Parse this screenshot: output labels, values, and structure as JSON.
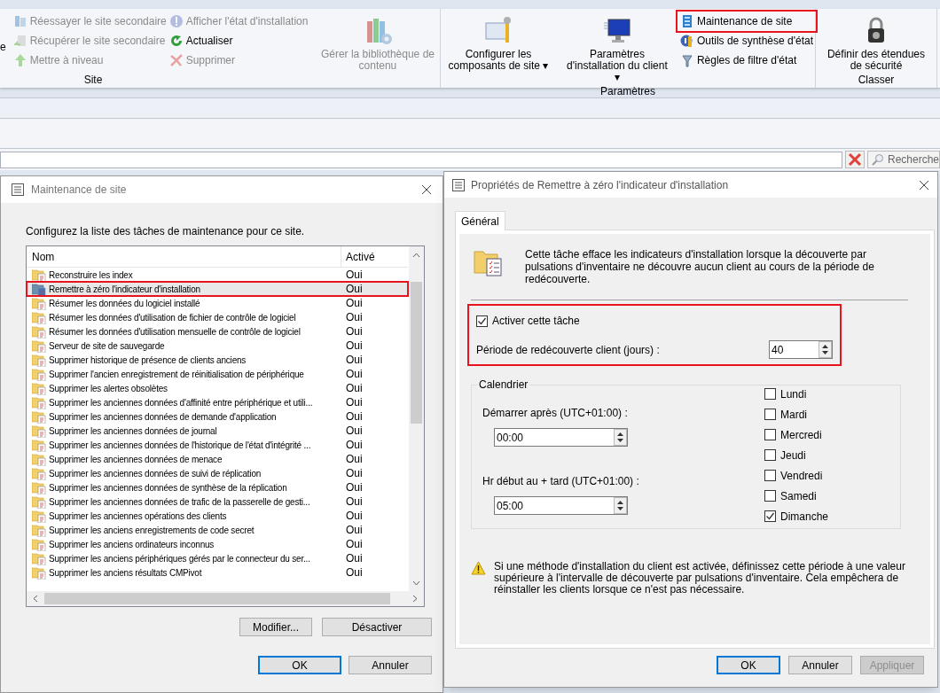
{
  "ribbon": {
    "groups": [
      {
        "label": "Site",
        "items": [
          {
            "kind": "fragment",
            "label": "e",
            "disabled": false
          },
          {
            "kind": "small",
            "label": "Réessayer le site secondaire",
            "disabled": true
          },
          {
            "kind": "small",
            "label": "Récupérer le site secondaire",
            "disabled": true
          },
          {
            "kind": "small",
            "label": "Mettre à niveau",
            "disabled": true
          },
          {
            "kind": "small",
            "label": "Afficher l'état d'installation",
            "disabled": true
          },
          {
            "kind": "small",
            "label": "Actualiser",
            "disabled": false
          },
          {
            "kind": "small",
            "label": "Supprimer",
            "disabled": true
          },
          {
            "kind": "large",
            "label": "Gérer la bibliothèque de contenu",
            "disabled": true
          }
        ]
      },
      {
        "label": "Paramètres",
        "items": [
          {
            "kind": "large",
            "label": "Configurer les composants de site",
            "disabled": false,
            "caret": "▾"
          },
          {
            "kind": "large",
            "label": "Paramètres d'installation du client",
            "disabled": false,
            "caret": "▾"
          },
          {
            "kind": "small",
            "label": "Maintenance de site",
            "disabled": false,
            "highlighted": true
          },
          {
            "kind": "small",
            "label": "Outils de synthèse d'état",
            "disabled": false,
            "highlighted": false
          },
          {
            "kind": "small",
            "label": "Règles de filtre d'état",
            "disabled": false,
            "highlighted": false
          }
        ]
      },
      {
        "label": "Classer",
        "items": [
          {
            "kind": "large",
            "label": "Définir des étendues de sécurité",
            "disabled": false
          }
        ]
      }
    ]
  },
  "search": {
    "button": "Recherche"
  },
  "maintenance_dialog": {
    "title": "Maintenance de site",
    "instruction": "Configurez la liste des tâches de maintenance pour ce site.",
    "columns": [
      "Nom",
      "Activé"
    ],
    "rows": [
      {
        "name": "Reconstruire les index",
        "enabled": "Oui",
        "selected": false,
        "highlighted": false
      },
      {
        "name": "Remettre à zéro l'indicateur d'installation",
        "enabled": "Oui",
        "selected": true,
        "highlighted": true
      },
      {
        "name": "Résumer les données du logiciel installé",
        "enabled": "Oui",
        "selected": false,
        "highlighted": false
      },
      {
        "name": "Résumer les données d'utilisation de fichier de contrôle de logiciel",
        "enabled": "Oui",
        "selected": false,
        "highlighted": false
      },
      {
        "name": "Résumer les données d'utilisation mensuelle de contrôle de logiciel",
        "enabled": "Oui",
        "selected": false,
        "highlighted": false
      },
      {
        "name": "Serveur de site de sauvegarde",
        "enabled": "Oui",
        "selected": false,
        "highlighted": false
      },
      {
        "name": "Supprimer historique de présence de clients anciens",
        "enabled": "Oui",
        "selected": false,
        "highlighted": false
      },
      {
        "name": "Supprimer l'ancien enregistrement de réinitialisation de périphérique",
        "enabled": "Oui",
        "selected": false,
        "highlighted": false
      },
      {
        "name": "Supprimer les alertes obsolètes",
        "enabled": "Oui",
        "selected": false,
        "highlighted": false
      },
      {
        "name": "Supprimer les anciennes données d'affinité entre périphérique et utili...",
        "enabled": "Oui",
        "selected": false,
        "highlighted": false
      },
      {
        "name": "Supprimer les anciennes données de demande d'application",
        "enabled": "Oui",
        "selected": false,
        "highlighted": false
      },
      {
        "name": "Supprimer les anciennes données de journal",
        "enabled": "Oui",
        "selected": false,
        "highlighted": false
      },
      {
        "name": "Supprimer les anciennes données de l'historique de l'état d'intégrité ...",
        "enabled": "Oui",
        "selected": false,
        "highlighted": false
      },
      {
        "name": "Supprimer les anciennes données de menace",
        "enabled": "Oui",
        "selected": false,
        "highlighted": false
      },
      {
        "name": "Supprimer les anciennes données de suivi de réplication",
        "enabled": "Oui",
        "selected": false,
        "highlighted": false
      },
      {
        "name": "Supprimer les anciennes données de synthèse de la réplication",
        "enabled": "Oui",
        "selected": false,
        "highlighted": false
      },
      {
        "name": "Supprimer les anciennes données de trafic de la passerelle de gesti...",
        "enabled": "Oui",
        "selected": false,
        "highlighted": false
      },
      {
        "name": "Supprimer les anciennes opérations des clients",
        "enabled": "Oui",
        "selected": false,
        "highlighted": false
      },
      {
        "name": "Supprimer les anciens enregistrements de code secret",
        "enabled": "Oui",
        "selected": false,
        "highlighted": false
      },
      {
        "name": "Supprimer les anciens ordinateurs inconnus",
        "enabled": "Oui",
        "selected": false,
        "highlighted": false
      },
      {
        "name": "Supprimer les anciens périphériques gérés par le connecteur du ser...",
        "enabled": "Oui",
        "selected": false,
        "highlighted": false
      },
      {
        "name": "Supprimer les anciens résultats CMPivot",
        "enabled": "Oui",
        "selected": false,
        "highlighted": false
      }
    ],
    "list_buttons": [
      {
        "label": "Modifier...",
        "default": false,
        "disabled": false
      },
      {
        "label": "Désactiver",
        "default": false,
        "disabled": false
      }
    ],
    "buttons": [
      {
        "label": "OK",
        "default": true,
        "disabled": false
      },
      {
        "label": "Annuler",
        "default": false,
        "disabled": false
      }
    ]
  },
  "properties_dialog": {
    "title": "Propriétés de Remettre à zéro l'indicateur d'installation",
    "tabs": [
      {
        "label": "Général",
        "selected": true
      }
    ],
    "description": "Cette tâche efface les indicateurs d'installation lorsque la découverte par pulsations d'inventaire ne découvre aucun client au cours de la période de redécouverte.",
    "settings_highlighted": true,
    "enable_task": {
      "label": "Activer cette tâche",
      "checked": true
    },
    "period": {
      "label": "Période de redécouverte client (jours) :",
      "value": "40"
    },
    "schedule": {
      "title": "Calendrier",
      "start": {
        "label": "Démarrer après (UTC+01:00) :",
        "value": "00:00"
      },
      "latest": {
        "label": "Hr début au + tard (UTC+01:00) :",
        "value": "05:00"
      },
      "days": [
        {
          "label": "Lundi",
          "checked": false
        },
        {
          "label": "Mardi",
          "checked": false
        },
        {
          "label": "Mercredi",
          "checked": false
        },
        {
          "label": "Jeudi",
          "checked": false
        },
        {
          "label": "Vendredi",
          "checked": false
        },
        {
          "label": "Samedi",
          "checked": false
        },
        {
          "label": "Dimanche",
          "checked": true
        }
      ]
    },
    "warning": "Si une méthode d'installation du client est activée, définissez cette période à une valeur supérieure à l'intervalle de découverte par pulsations d'inventaire. Cela empêchera de réinstaller les clients lorsque ce n'est pas nécessaire.",
    "buttons": [
      {
        "label": "OK",
        "default": true,
        "disabled": false
      },
      {
        "label": "Annuler",
        "default": false,
        "disabled": false
      },
      {
        "label": "Appliquer",
        "default": false,
        "disabled": true
      }
    ]
  }
}
